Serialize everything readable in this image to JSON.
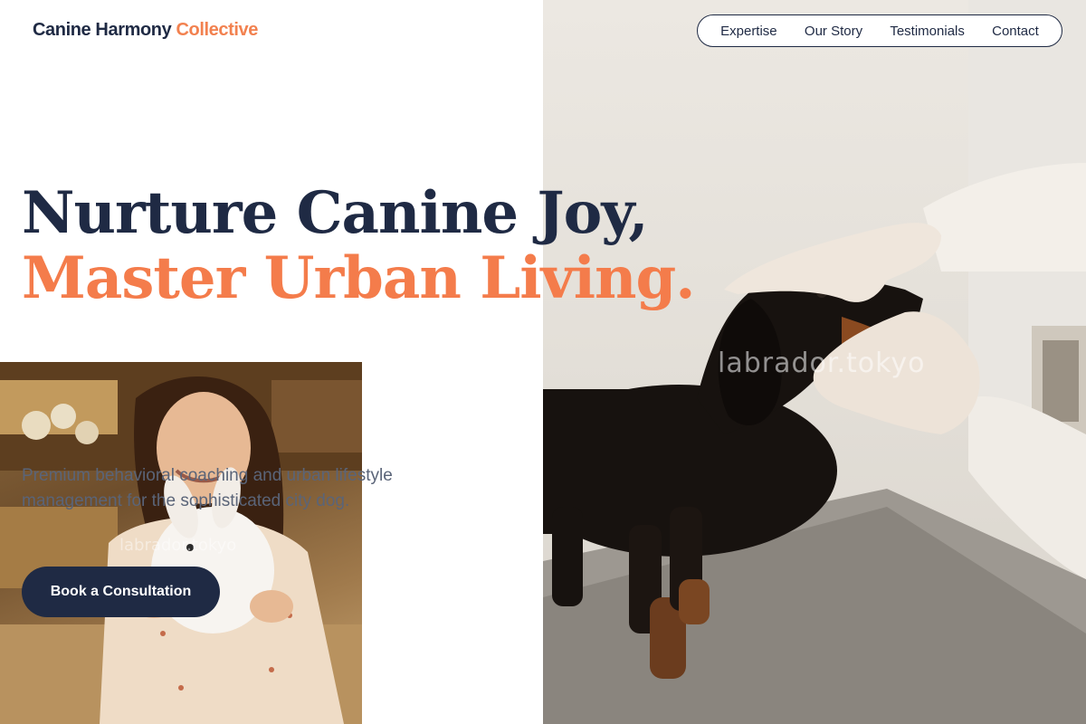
{
  "brand": {
    "name": "Canine Harmony",
    "accent": "Collective"
  },
  "nav": {
    "items": [
      "Expertise",
      "Our Story",
      "Testimonials",
      "Contact"
    ]
  },
  "hero": {
    "headline_line1": "Nurture Canine Joy,",
    "headline_line2": "Master Urban Living.",
    "subtext": "Premium behavioral coaching and urban lifestyle management for the sophisticated city dog.",
    "cta_label": "Book a Consultation"
  },
  "images": {
    "hero_watermark": "labrador.tokyo",
    "inset_watermark": "labrador.tokyo"
  },
  "colors": {
    "navy": "#1f2a44",
    "accent": "#f47c4b",
    "muted": "#5a6478"
  }
}
